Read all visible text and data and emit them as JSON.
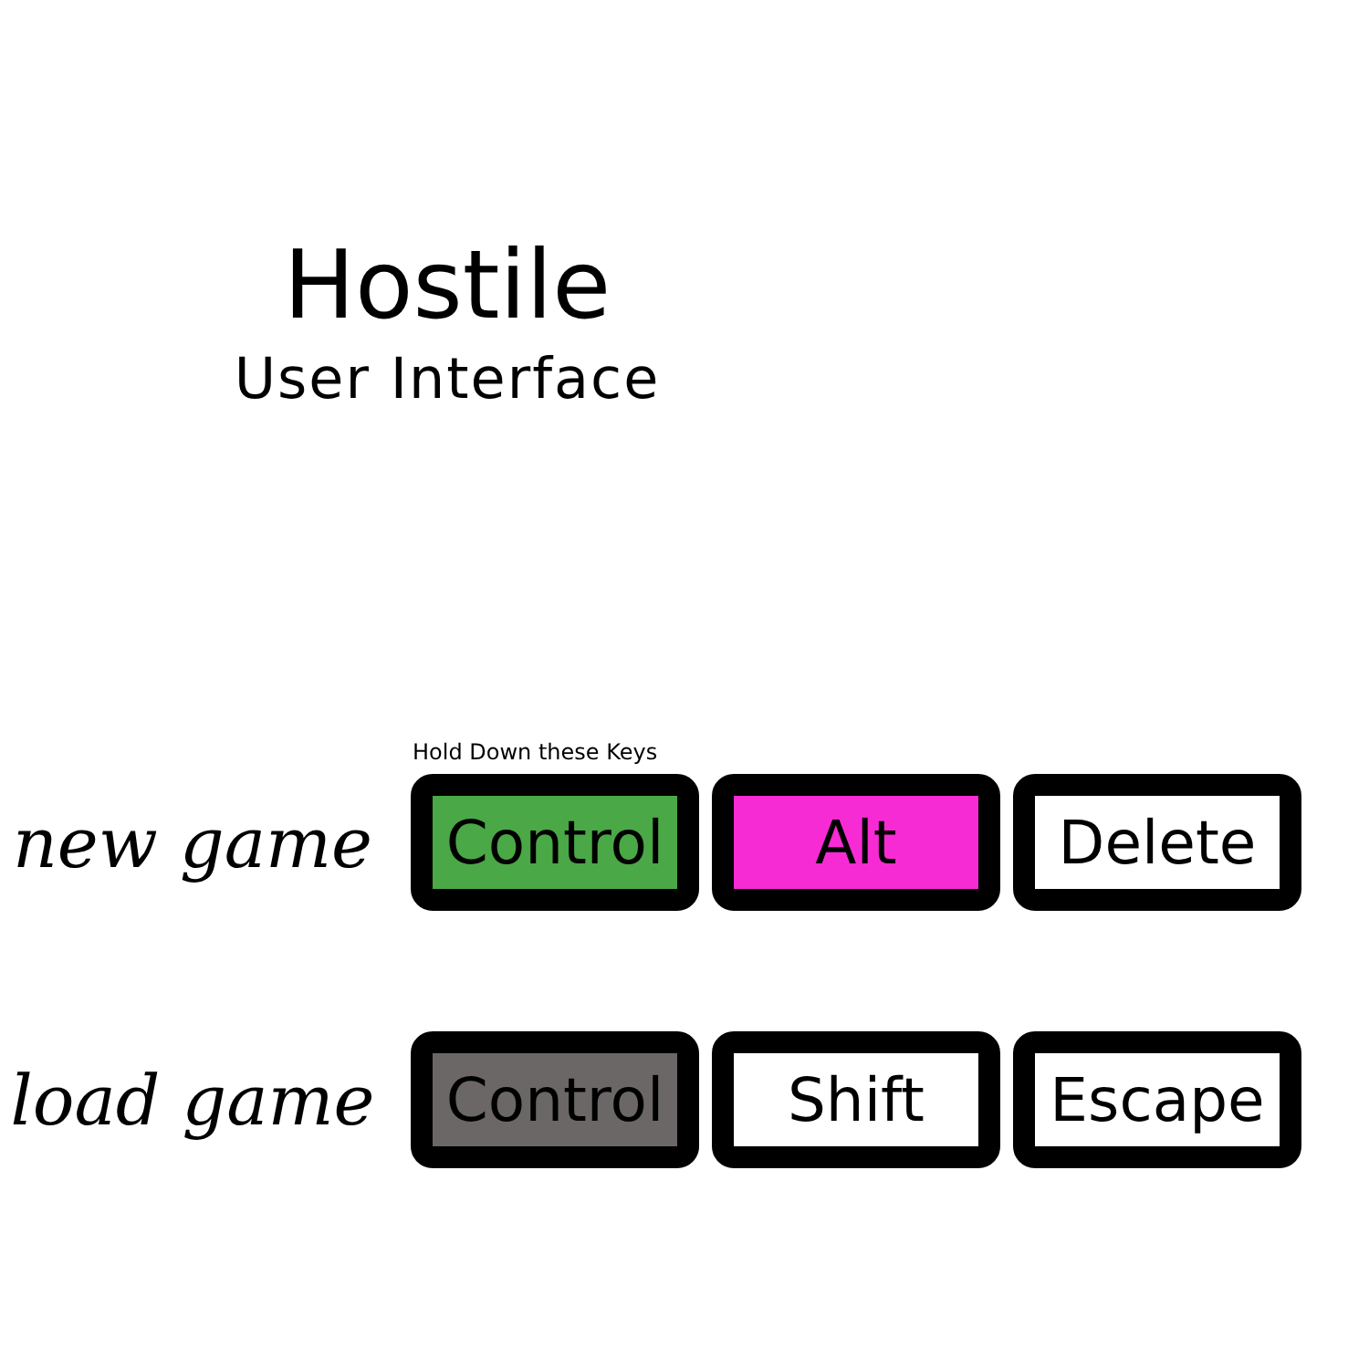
{
  "title": "Hostile",
  "subtitle": "User Interface",
  "menu": [
    {
      "label": "new game",
      "hint": "Hold Down these Keys",
      "keys": [
        {
          "label": "Control",
          "color": "#4aa846"
        },
        {
          "label": "Alt",
          "color": "#f72bd4"
        },
        {
          "label": "Delete",
          "color": "#ffffff"
        }
      ]
    },
    {
      "label": "load game",
      "keys": [
        {
          "label": "Control",
          "color": "#6b6767"
        },
        {
          "label": "Shift",
          "color": "#ffffff"
        },
        {
          "label": "Escape",
          "color": "#ffffff"
        }
      ]
    }
  ]
}
